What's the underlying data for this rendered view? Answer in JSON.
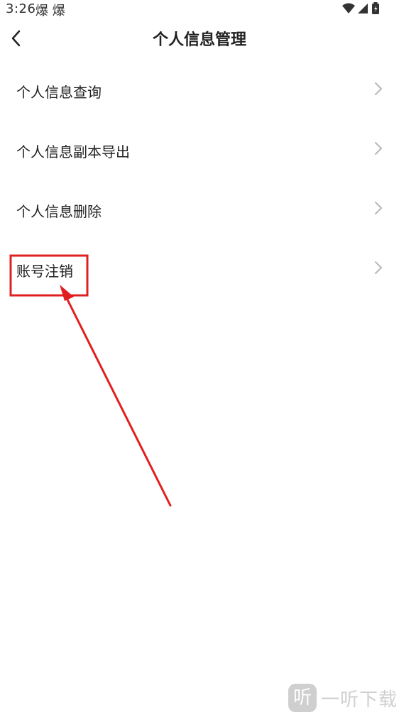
{
  "status_bar": {
    "time": "3:26",
    "app_icons": "爆 爆"
  },
  "header": {
    "title": "个人信息管理"
  },
  "menu": {
    "items": [
      {
        "label": "个人信息查询"
      },
      {
        "label": "个人信息副本导出"
      },
      {
        "label": "个人信息删除"
      },
      {
        "label": "账号注销"
      }
    ]
  },
  "watermark": {
    "logo_char": "听",
    "text": "一听下载"
  },
  "colors": {
    "text": "#222222",
    "chevron": "#bbbbbb",
    "annotation": "#e02020",
    "watermark": "#cfcfcf"
  }
}
